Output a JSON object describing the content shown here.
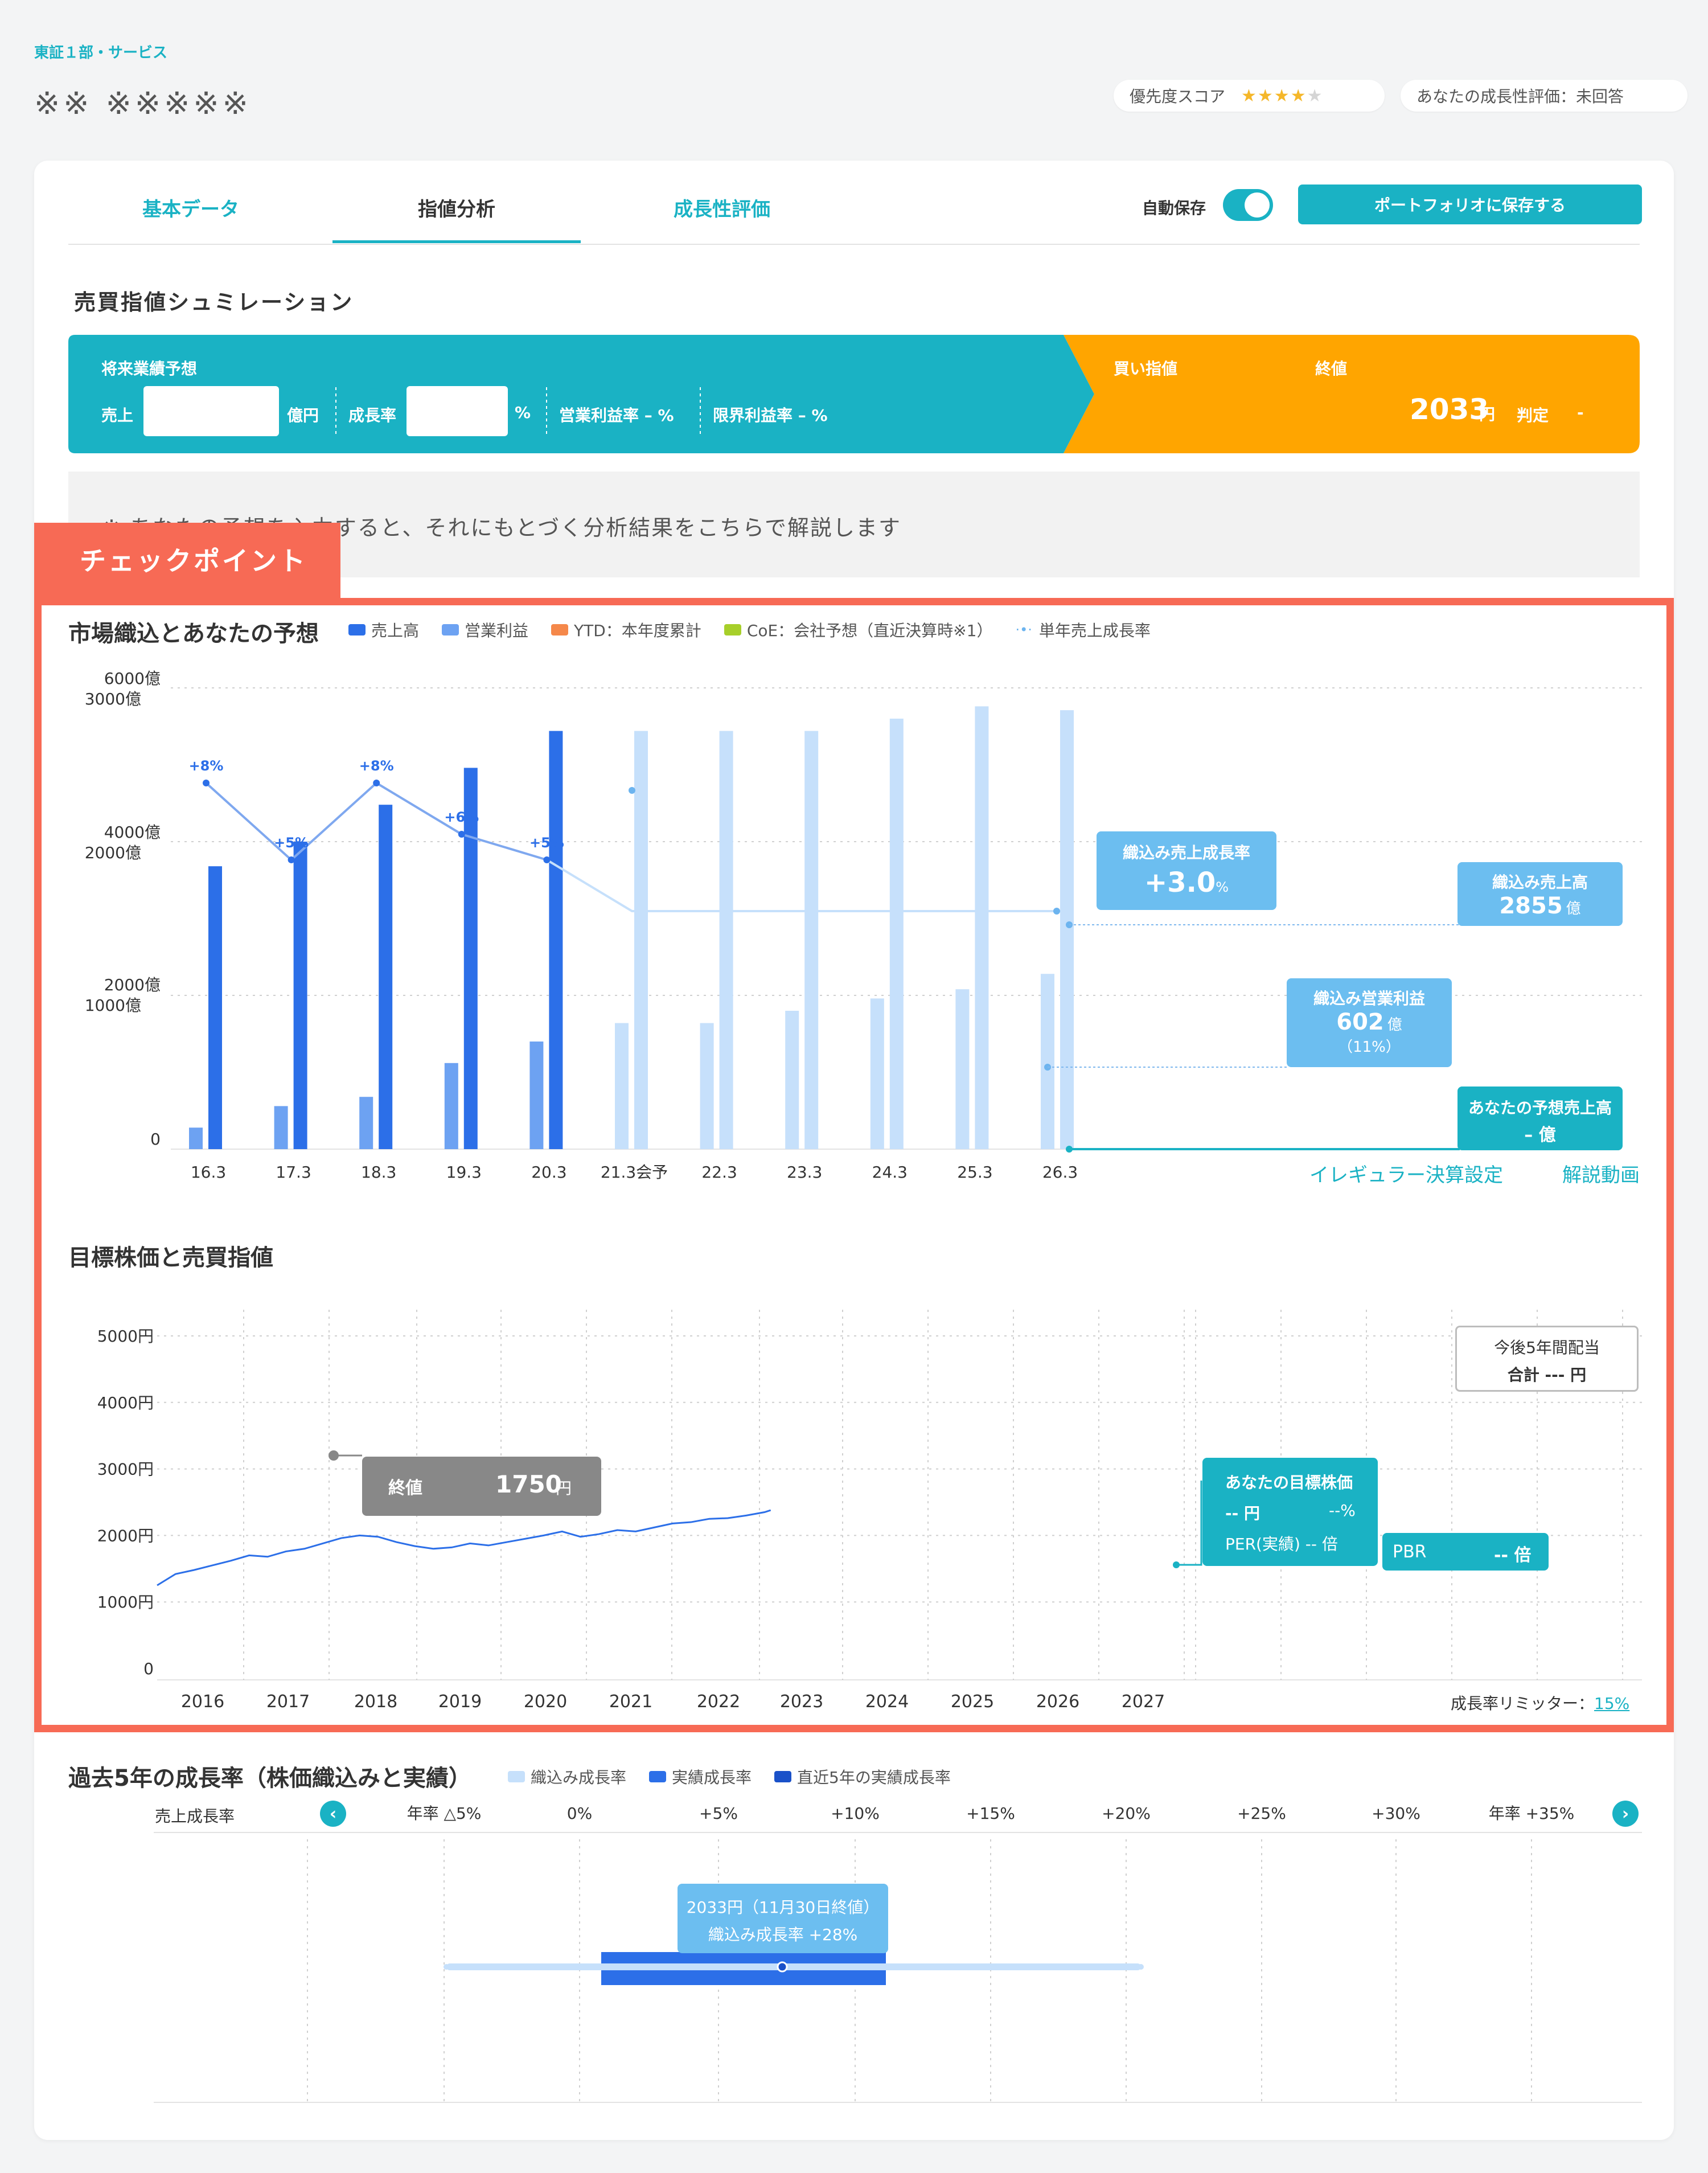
{
  "header": {
    "sector": "東証１部・サービス",
    "company": "※※ ※※※※※",
    "score_label": "優先度スコア",
    "score_stars": 4,
    "score_max": 5,
    "growth_eval": "あなたの成長性評価：未回答"
  },
  "tabs": [
    {
      "label": "基本データ"
    },
    {
      "label": "指値分析"
    },
    {
      "label": "成長性評価"
    }
  ],
  "toolbar": {
    "autosave_label": "自動保存",
    "autosave_on": true,
    "save_button": "ポートフォリオに保存する"
  },
  "simulation": {
    "title": "売買指値シュミレーション",
    "forecast_title": "将来業績予想",
    "sales_label": "売上",
    "sales_unit": "億円",
    "growth_label": "成長率",
    "growth_unit": "%",
    "op_margin": "営業利益率 – %",
    "marginal_margin": "限界利益率 – %",
    "buy_label": "買い指値",
    "close_label": "終値",
    "close_value": "2033",
    "close_unit": "円",
    "judge_label": "判定",
    "judge_value": "-",
    "colors": {
      "teal": "#1ab2c4",
      "orange": "#ffa500"
    }
  },
  "note": "※ あなたの予想を入力すると、それにもとづく分析結果をこちらで解説します",
  "checkpoint": {
    "label": "チェックポイント",
    "color": "#f76a55"
  },
  "chart1": {
    "title": "市場織込とあなたの予想",
    "legend": [
      {
        "label": "売上高",
        "color": "#2c6fe8"
      },
      {
        "label": "営業利益",
        "color": "#6da2f2"
      },
      {
        "label": "YTD：本年度累計",
        "color": "#f5884a"
      },
      {
        "label": "CoE：会社予想（直近決算時※1）",
        "color": "#a7cf2a"
      },
      {
        "label": "単年売上成長率",
        "color": "#6cb4ef"
      }
    ],
    "yticks": [
      {
        "a": "6000億",
        "b": "3000億"
      },
      {
        "a": "4000億",
        "b": "2000億"
      },
      {
        "a": "2000億",
        "b": "1000億"
      },
      {
        "a": "",
        "b": "0"
      }
    ],
    "tooltips": {
      "growth_title": "織込み売上成長率",
      "growth_value": "+3.0",
      "growth_unit": "%",
      "sales_title": "織込み売上高",
      "sales_value": "2855",
      "sales_unit": "億",
      "op_title": "織込み営業利益",
      "op_value": "602",
      "op_unit": "億",
      "op_pct": "（11%）",
      "your_title": "あなたの予想売上高",
      "your_value": "– 億"
    },
    "links": {
      "irregular": "イレギュラー決算設定",
      "video": "解説動画"
    }
  },
  "chart_data": [
    {
      "type": "bar",
      "title": "市場織込とあなたの予想",
      "categories": [
        "16.3",
        "17.3",
        "18.3",
        "19.3",
        "20.3",
        "21.3会予",
        "22.3",
        "23.3",
        "24.3",
        "25.3",
        "26.3"
      ],
      "series": [
        {
          "name": "売上高",
          "values": [
            1840,
            2000,
            2240,
            2480,
            2720,
            2720,
            2720,
            2720,
            2800,
            2880,
            2855
          ]
        },
        {
          "name": "営業利益",
          "values": [
            140,
            280,
            340,
            560,
            700,
            820,
            820,
            900,
            980,
            1040,
            1140
          ]
        },
        {
          "name": "単年売上成長率",
          "values": [
            8,
            5,
            8,
            6,
            5,
            3,
            3,
            3,
            3,
            3,
            3
          ],
          "labels": [
            "+8%",
            "+5%",
            "+8%",
            "+6%",
            "+5%",
            "",
            "",
            "",
            "",
            "",
            ""
          ]
        }
      ],
      "ylim": [
        0,
        6000
      ],
      "ylabel_left": [
        "6000億",
        "4000億",
        "2000億"
      ],
      "ylabel_right": [
        "3000億",
        "2000億",
        "1000億",
        "0"
      ]
    },
    {
      "type": "line",
      "title": "目標株価と売買指値",
      "x_ticks": [
        "2016",
        "2017",
        "2018",
        "2019",
        "2020",
        "2021",
        "2022",
        "2023",
        "2024",
        "2025",
        "2026",
        "2027"
      ],
      "y_ticks": [
        "5000円",
        "4000円",
        "3000円",
        "2000円",
        "1000円",
        "0"
      ],
      "ylim": [
        0,
        5000
      ],
      "xlim": [
        2015.7,
        2027.8
      ],
      "series": [
        {
          "name": "株価",
          "x": [
            2015.7,
            2015.85,
            2016.0,
            2016.15,
            2016.3,
            2016.45,
            2016.6,
            2016.75,
            2016.9,
            2017.05,
            2017.2,
            2017.35,
            2017.5,
            2017.65,
            2017.8,
            2017.95,
            2018.1,
            2018.25,
            2018.4,
            2018.55,
            2018.7,
            2018.85,
            2019.0,
            2019.15,
            2019.3,
            2019.45,
            2019.6,
            2019.75,
            2019.9,
            2020.05,
            2020.2,
            2020.35,
            2020.5,
            2020.65,
            2020.7
          ],
          "y": [
            1250,
            1420,
            1480,
            1550,
            1620,
            1700,
            1680,
            1760,
            1800,
            1880,
            1960,
            2000,
            1980,
            1900,
            1840,
            1800,
            1820,
            1880,
            1850,
            1900,
            1950,
            2000,
            2060,
            1980,
            2020,
            2080,
            2060,
            2120,
            2180,
            2200,
            2250,
            2260,
            2300,
            2350,
            2380
          ]
        }
      ]
    },
    {
      "type": "bar",
      "title": "過去5年の成長率（株価織込みと実績）",
      "categories": [
        "年率 △5%",
        "0%",
        "+5%",
        "+10%",
        "+15%",
        "+20%",
        "+25%",
        "+30%",
        "年率 +35%"
      ],
      "series": [
        {
          "name": "織込み成長率",
          "range": [
            -5,
            20
          ]
        },
        {
          "name": "実績成長率",
          "range": [
            0,
            10
          ]
        },
        {
          "name": "直近5年の実績成長率",
          "value": 7
        }
      ]
    }
  ],
  "chart2": {
    "title": "目標株価と売買指値",
    "dividend_line1": "今後5年間配当",
    "dividend_line2": "合計  ---  円",
    "close_label": "終値",
    "close_value": "1750",
    "close_unit": "円",
    "target_title": "あなたの目標株価",
    "target_line1_a": "-- 円",
    "target_line1_b": "--%",
    "target_line2": "PER(実績) -- 倍",
    "pbr_label": "PBR",
    "pbr_value": "-- 倍",
    "limiter_label": "成長率リミッター：",
    "limiter_value": "15%"
  },
  "chart3": {
    "title": "過去5年の成長率（株価織込みと実績）",
    "legend": [
      {
        "label": "織込み成長率",
        "color": "#c6e0fb"
      },
      {
        "label": "実績成長率",
        "color": "#2c6fe8"
      },
      {
        "label": "直近5年の実績成長率",
        "color": "#1a51c9"
      }
    ],
    "row_label": "売上成長率",
    "tooltip_line1": "2033円（11月30日終値）",
    "tooltip_line2": "織込み成長率 +28%"
  }
}
